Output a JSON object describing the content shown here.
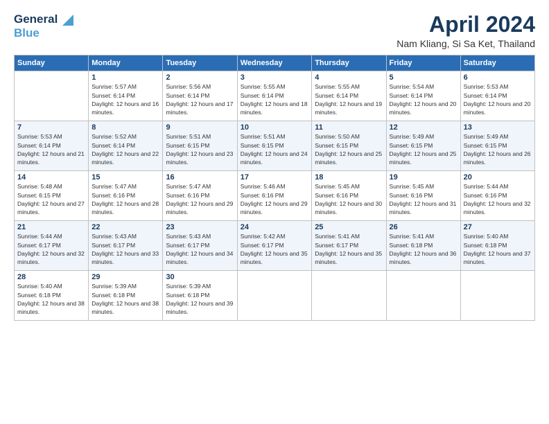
{
  "header": {
    "logo_general": "General",
    "logo_blue": "Blue",
    "month_title": "April 2024",
    "location": "Nam Kliang, Si Sa Ket, Thailand"
  },
  "days_of_week": [
    "Sunday",
    "Monday",
    "Tuesday",
    "Wednesday",
    "Thursday",
    "Friday",
    "Saturday"
  ],
  "weeks": [
    [
      {
        "day": "",
        "sunrise": "",
        "sunset": "",
        "daylight": ""
      },
      {
        "day": "1",
        "sunrise": "Sunrise: 5:57 AM",
        "sunset": "Sunset: 6:14 PM",
        "daylight": "Daylight: 12 hours and 16 minutes."
      },
      {
        "day": "2",
        "sunrise": "Sunrise: 5:56 AM",
        "sunset": "Sunset: 6:14 PM",
        "daylight": "Daylight: 12 hours and 17 minutes."
      },
      {
        "day": "3",
        "sunrise": "Sunrise: 5:55 AM",
        "sunset": "Sunset: 6:14 PM",
        "daylight": "Daylight: 12 hours and 18 minutes."
      },
      {
        "day": "4",
        "sunrise": "Sunrise: 5:55 AM",
        "sunset": "Sunset: 6:14 PM",
        "daylight": "Daylight: 12 hours and 19 minutes."
      },
      {
        "day": "5",
        "sunrise": "Sunrise: 5:54 AM",
        "sunset": "Sunset: 6:14 PM",
        "daylight": "Daylight: 12 hours and 20 minutes."
      },
      {
        "day": "6",
        "sunrise": "Sunrise: 5:53 AM",
        "sunset": "Sunset: 6:14 PM",
        "daylight": "Daylight: 12 hours and 20 minutes."
      }
    ],
    [
      {
        "day": "7",
        "sunrise": "Sunrise: 5:53 AM",
        "sunset": "Sunset: 6:14 PM",
        "daylight": "Daylight: 12 hours and 21 minutes."
      },
      {
        "day": "8",
        "sunrise": "Sunrise: 5:52 AM",
        "sunset": "Sunset: 6:14 PM",
        "daylight": "Daylight: 12 hours and 22 minutes."
      },
      {
        "day": "9",
        "sunrise": "Sunrise: 5:51 AM",
        "sunset": "Sunset: 6:15 PM",
        "daylight": "Daylight: 12 hours and 23 minutes."
      },
      {
        "day": "10",
        "sunrise": "Sunrise: 5:51 AM",
        "sunset": "Sunset: 6:15 PM",
        "daylight": "Daylight: 12 hours and 24 minutes."
      },
      {
        "day": "11",
        "sunrise": "Sunrise: 5:50 AM",
        "sunset": "Sunset: 6:15 PM",
        "daylight": "Daylight: 12 hours and 25 minutes."
      },
      {
        "day": "12",
        "sunrise": "Sunrise: 5:49 AM",
        "sunset": "Sunset: 6:15 PM",
        "daylight": "Daylight: 12 hours and 25 minutes."
      },
      {
        "day": "13",
        "sunrise": "Sunrise: 5:49 AM",
        "sunset": "Sunset: 6:15 PM",
        "daylight": "Daylight: 12 hours and 26 minutes."
      }
    ],
    [
      {
        "day": "14",
        "sunrise": "Sunrise: 5:48 AM",
        "sunset": "Sunset: 6:15 PM",
        "daylight": "Daylight: 12 hours and 27 minutes."
      },
      {
        "day": "15",
        "sunrise": "Sunrise: 5:47 AM",
        "sunset": "Sunset: 6:16 PM",
        "daylight": "Daylight: 12 hours and 28 minutes."
      },
      {
        "day": "16",
        "sunrise": "Sunrise: 5:47 AM",
        "sunset": "Sunset: 6:16 PM",
        "daylight": "Daylight: 12 hours and 29 minutes."
      },
      {
        "day": "17",
        "sunrise": "Sunrise: 5:46 AM",
        "sunset": "Sunset: 6:16 PM",
        "daylight": "Daylight: 12 hours and 29 minutes."
      },
      {
        "day": "18",
        "sunrise": "Sunrise: 5:45 AM",
        "sunset": "Sunset: 6:16 PM",
        "daylight": "Daylight: 12 hours and 30 minutes."
      },
      {
        "day": "19",
        "sunrise": "Sunrise: 5:45 AM",
        "sunset": "Sunset: 6:16 PM",
        "daylight": "Daylight: 12 hours and 31 minutes."
      },
      {
        "day": "20",
        "sunrise": "Sunrise: 5:44 AM",
        "sunset": "Sunset: 6:16 PM",
        "daylight": "Daylight: 12 hours and 32 minutes."
      }
    ],
    [
      {
        "day": "21",
        "sunrise": "Sunrise: 5:44 AM",
        "sunset": "Sunset: 6:17 PM",
        "daylight": "Daylight: 12 hours and 32 minutes."
      },
      {
        "day": "22",
        "sunrise": "Sunrise: 5:43 AM",
        "sunset": "Sunset: 6:17 PM",
        "daylight": "Daylight: 12 hours and 33 minutes."
      },
      {
        "day": "23",
        "sunrise": "Sunrise: 5:43 AM",
        "sunset": "Sunset: 6:17 PM",
        "daylight": "Daylight: 12 hours and 34 minutes."
      },
      {
        "day": "24",
        "sunrise": "Sunrise: 5:42 AM",
        "sunset": "Sunset: 6:17 PM",
        "daylight": "Daylight: 12 hours and 35 minutes."
      },
      {
        "day": "25",
        "sunrise": "Sunrise: 5:41 AM",
        "sunset": "Sunset: 6:17 PM",
        "daylight": "Daylight: 12 hours and 35 minutes."
      },
      {
        "day": "26",
        "sunrise": "Sunrise: 5:41 AM",
        "sunset": "Sunset: 6:18 PM",
        "daylight": "Daylight: 12 hours and 36 minutes."
      },
      {
        "day": "27",
        "sunrise": "Sunrise: 5:40 AM",
        "sunset": "Sunset: 6:18 PM",
        "daylight": "Daylight: 12 hours and 37 minutes."
      }
    ],
    [
      {
        "day": "28",
        "sunrise": "Sunrise: 5:40 AM",
        "sunset": "Sunset: 6:18 PM",
        "daylight": "Daylight: 12 hours and 38 minutes."
      },
      {
        "day": "29",
        "sunrise": "Sunrise: 5:39 AM",
        "sunset": "Sunset: 6:18 PM",
        "daylight": "Daylight: 12 hours and 38 minutes."
      },
      {
        "day": "30",
        "sunrise": "Sunrise: 5:39 AM",
        "sunset": "Sunset: 6:18 PM",
        "daylight": "Daylight: 12 hours and 39 minutes."
      },
      {
        "day": "",
        "sunrise": "",
        "sunset": "",
        "daylight": ""
      },
      {
        "day": "",
        "sunrise": "",
        "sunset": "",
        "daylight": ""
      },
      {
        "day": "",
        "sunrise": "",
        "sunset": "",
        "daylight": ""
      },
      {
        "day": "",
        "sunrise": "",
        "sunset": "",
        "daylight": ""
      }
    ]
  ]
}
